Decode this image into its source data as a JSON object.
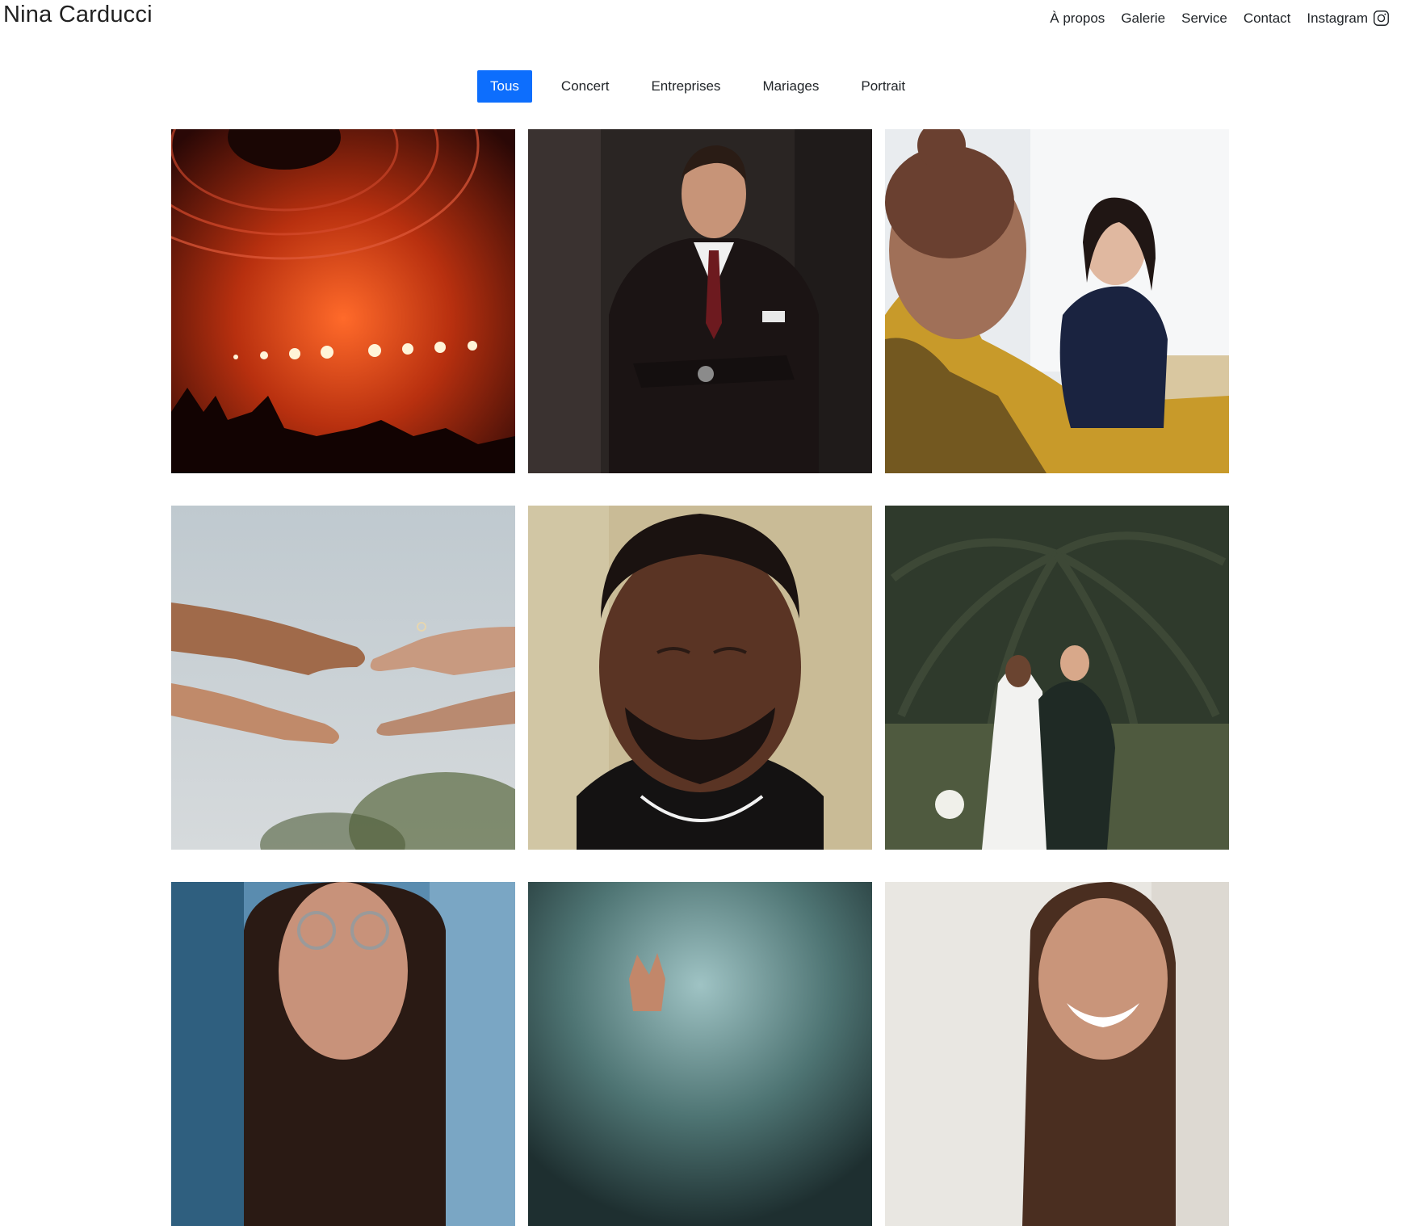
{
  "header": {
    "brand": "Nina Carducci",
    "nav": [
      {
        "label": "À propos"
      },
      {
        "label": "Galerie"
      },
      {
        "label": "Service"
      },
      {
        "label": "Contact"
      },
      {
        "label": "Instagram",
        "icon": "instagram-icon"
      }
    ]
  },
  "filters": {
    "active_color": "#0d6efd",
    "items": [
      {
        "label": "Tous",
        "active": true
      },
      {
        "label": "Concert",
        "active": false
      },
      {
        "label": "Entreprises",
        "active": false
      },
      {
        "label": "Mariages",
        "active": false
      },
      {
        "label": "Portrait",
        "active": false
      }
    ]
  },
  "gallery": {
    "photos": [
      {
        "subject": "concert-stage"
      },
      {
        "subject": "man-in-suit-portrait"
      },
      {
        "subject": "business-meeting"
      },
      {
        "subject": "hands-wedding-ring"
      },
      {
        "subject": "man-eyes-closed-portrait"
      },
      {
        "subject": "wedding-couple-palm"
      },
      {
        "subject": "woman-glasses-portrait"
      },
      {
        "subject": "concert-smoke"
      },
      {
        "subject": "bride-smiling"
      }
    ]
  }
}
